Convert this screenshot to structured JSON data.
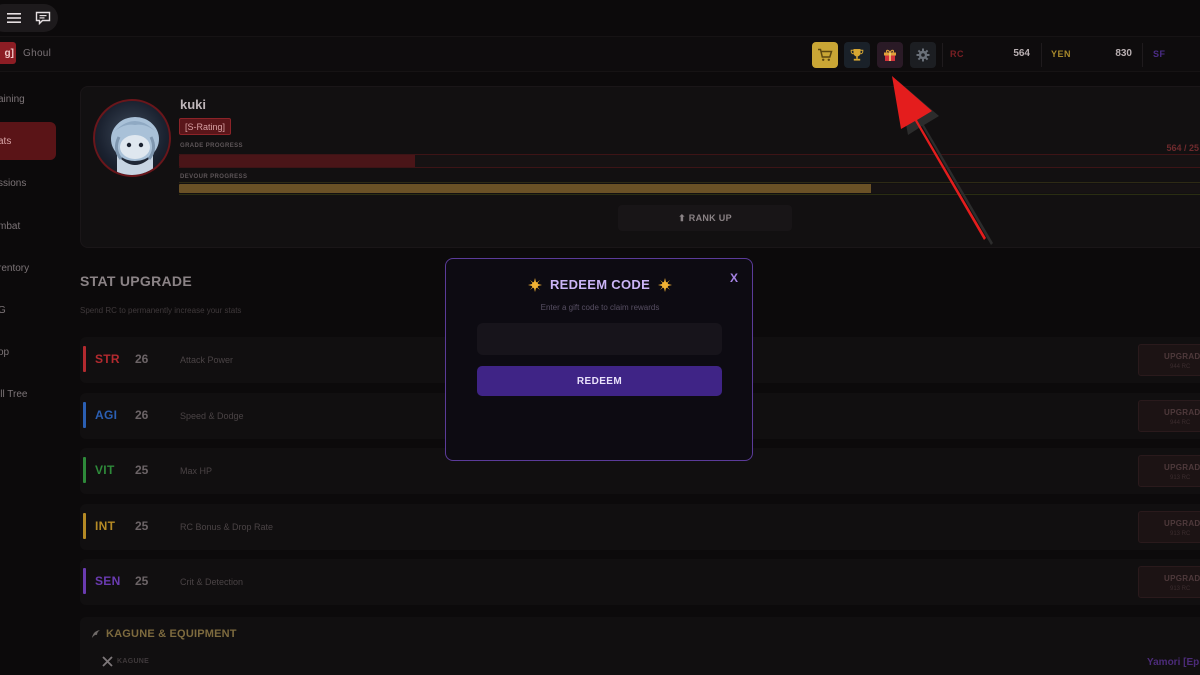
{
  "topbar": {
    "menu_icon": "hamburger-icon",
    "chat_icon": "chat-bubble-icon"
  },
  "header": {
    "rank_tag": "g]",
    "race": "Ghoul",
    "buttons": [
      {
        "name": "shop",
        "icon": "cart-icon",
        "color": "#c9a635"
      },
      {
        "name": "leaderboard",
        "icon": "trophy-icon",
        "color": "#1c2430"
      },
      {
        "name": "redeem",
        "icon": "gift-icon",
        "color": "#2a1a24"
      },
      {
        "name": "settings",
        "icon": "gear-icon",
        "color": "#1c1e22"
      }
    ],
    "currencies": {
      "rc": {
        "label": "RC",
        "value": "564",
        "color": "#7a1f24"
      },
      "yen": {
        "label": "YEN",
        "value": "830",
        "color": "#a7892b"
      },
      "sf": {
        "label": "SF",
        "color": "#4b2c86"
      }
    }
  },
  "sidebar": {
    "items": [
      {
        "label": "aining"
      },
      {
        "label": "ats"
      },
      {
        "label": "ssions"
      },
      {
        "label": "mbat"
      },
      {
        "label": "rentory"
      },
      {
        "label": "G"
      },
      {
        "label": "op"
      },
      {
        "label": "ill Tree"
      }
    ]
  },
  "profile": {
    "username": "kuki",
    "rating": "[S-Rating]",
    "grade_label": "GRADE PROGRESS",
    "grade_progress": 0.227,
    "grade_value": "564 / 25",
    "devour_label": "DEVOUR PROGRESS",
    "devour_progress": 0.665,
    "rank_up": "⬆ RANK UP"
  },
  "stat_upgrade": {
    "title": "STAT UPGRADE",
    "subtitle": "Spend RC to permanently increase your stats",
    "stats": [
      {
        "abbr": "STR",
        "value": "26",
        "desc": "Attack Power",
        "color": "#b32a2f",
        "upgrade": "UPGRADE",
        "cost": "944 RC"
      },
      {
        "abbr": "AGI",
        "value": "26",
        "desc": "Speed & Dodge",
        "color": "#2b5fb3",
        "upgrade": "UPGRADE",
        "cost": "944 RC"
      },
      {
        "abbr": "VIT",
        "value": "25",
        "desc": "Max HP",
        "color": "#2e8a3a",
        "upgrade": "UPGRADE",
        "cost": "913 RC"
      },
      {
        "abbr": "INT",
        "value": "25",
        "desc": "RC Bonus & Drop Rate",
        "color": "#b58a25",
        "upgrade": "UPGRADE",
        "cost": "913 RC"
      },
      {
        "abbr": "SEN",
        "value": "25",
        "desc": "Crit & Detection",
        "color": "#6a3bb0",
        "upgrade": "UPGRADE",
        "cost": "913 RC"
      }
    ]
  },
  "kagune": {
    "title": "KAGUNE & EQUIPMENT",
    "subtitle": "KAGUNE",
    "equipped": "Yamori  [Ep"
  },
  "modal": {
    "title": "REDEEM CODE",
    "subtitle": "Enter a gift code to claim rewards",
    "input_value": "",
    "button": "REDEEM",
    "close": "X"
  }
}
